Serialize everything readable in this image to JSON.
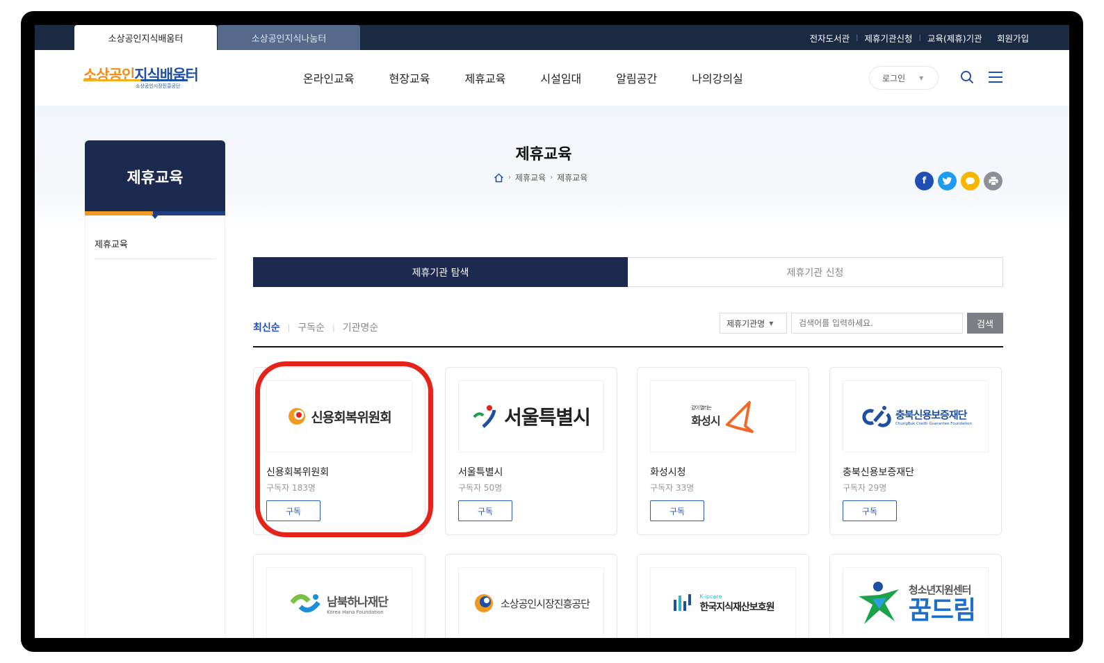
{
  "site_tabs": {
    "active": "소상공인지식배움터",
    "inactive": "소상공인지식나눔터"
  },
  "util_links": [
    "전자도서관",
    "제휴기관신청",
    "교육(제휴)기관",
    "회원가입"
  ],
  "logo": {
    "main_a": "소상공인",
    "main_b": "지식배움터",
    "sub": "소상공인시장진흥공단"
  },
  "gnb": [
    "온라인교육",
    "현장교육",
    "제휴교육",
    "시설임대",
    "알림공간",
    "나의강의실"
  ],
  "login": {
    "label": "로그인"
  },
  "sidebar": {
    "title": "제휴교육",
    "items": [
      "제휴교육"
    ]
  },
  "page": {
    "title": "제휴교육",
    "breadcrumb": [
      "제휴교육",
      "제휴교육"
    ]
  },
  "share": {
    "facebook": "f",
    "twitter": "t",
    "kakao": "k",
    "print": "p",
    "colors": {
      "facebook": "#1f4fb5",
      "twitter": "#1d9bf0",
      "kakao": "#f7b500",
      "print": "#8d9096"
    }
  },
  "tabs": [
    "제휴기관 탐색",
    "제휴기관 신청"
  ],
  "sort": [
    "최신순",
    "구독순",
    "기관명순"
  ],
  "search": {
    "select_value": "제휴기관명",
    "placeholder": "검색어를 입력하세요.",
    "button": "검색"
  },
  "subscribe_label": "구독",
  "cards": [
    {
      "name": "신용회복위원회",
      "subscribers": "구독자 183명",
      "logo_text": "신용회복위원회"
    },
    {
      "name": "서울특별시",
      "subscribers": "구독자 50명",
      "logo_text": "서울특별시"
    },
    {
      "name": "화성시청",
      "subscribers": "구독자 33명",
      "logo_text": "화성시",
      "logo_small": "같이 열리는"
    },
    {
      "name": "충북신용보증재단",
      "subscribers": "구독자 29명",
      "logo_text": "충북신용보증재단",
      "logo_small": "ChungBuk Credit Guarantee Foundation"
    }
  ],
  "cards_row2": [
    {
      "logo_text": "남북하나재단",
      "logo_small": "Korea Hana Foundation"
    },
    {
      "logo_text": "소상공인시장진흥공단"
    },
    {
      "logo_text": "한국지식재산보호원",
      "logo_small": "K-ipcare"
    },
    {
      "logo_text": "꿈드림",
      "logo_small": "청소년지원센터"
    }
  ],
  "colors": {
    "navy": "#1b2a4e",
    "accent_blue": "#1f4fb5",
    "highlight": "#e4231b",
    "orange": "#f29a1f"
  }
}
